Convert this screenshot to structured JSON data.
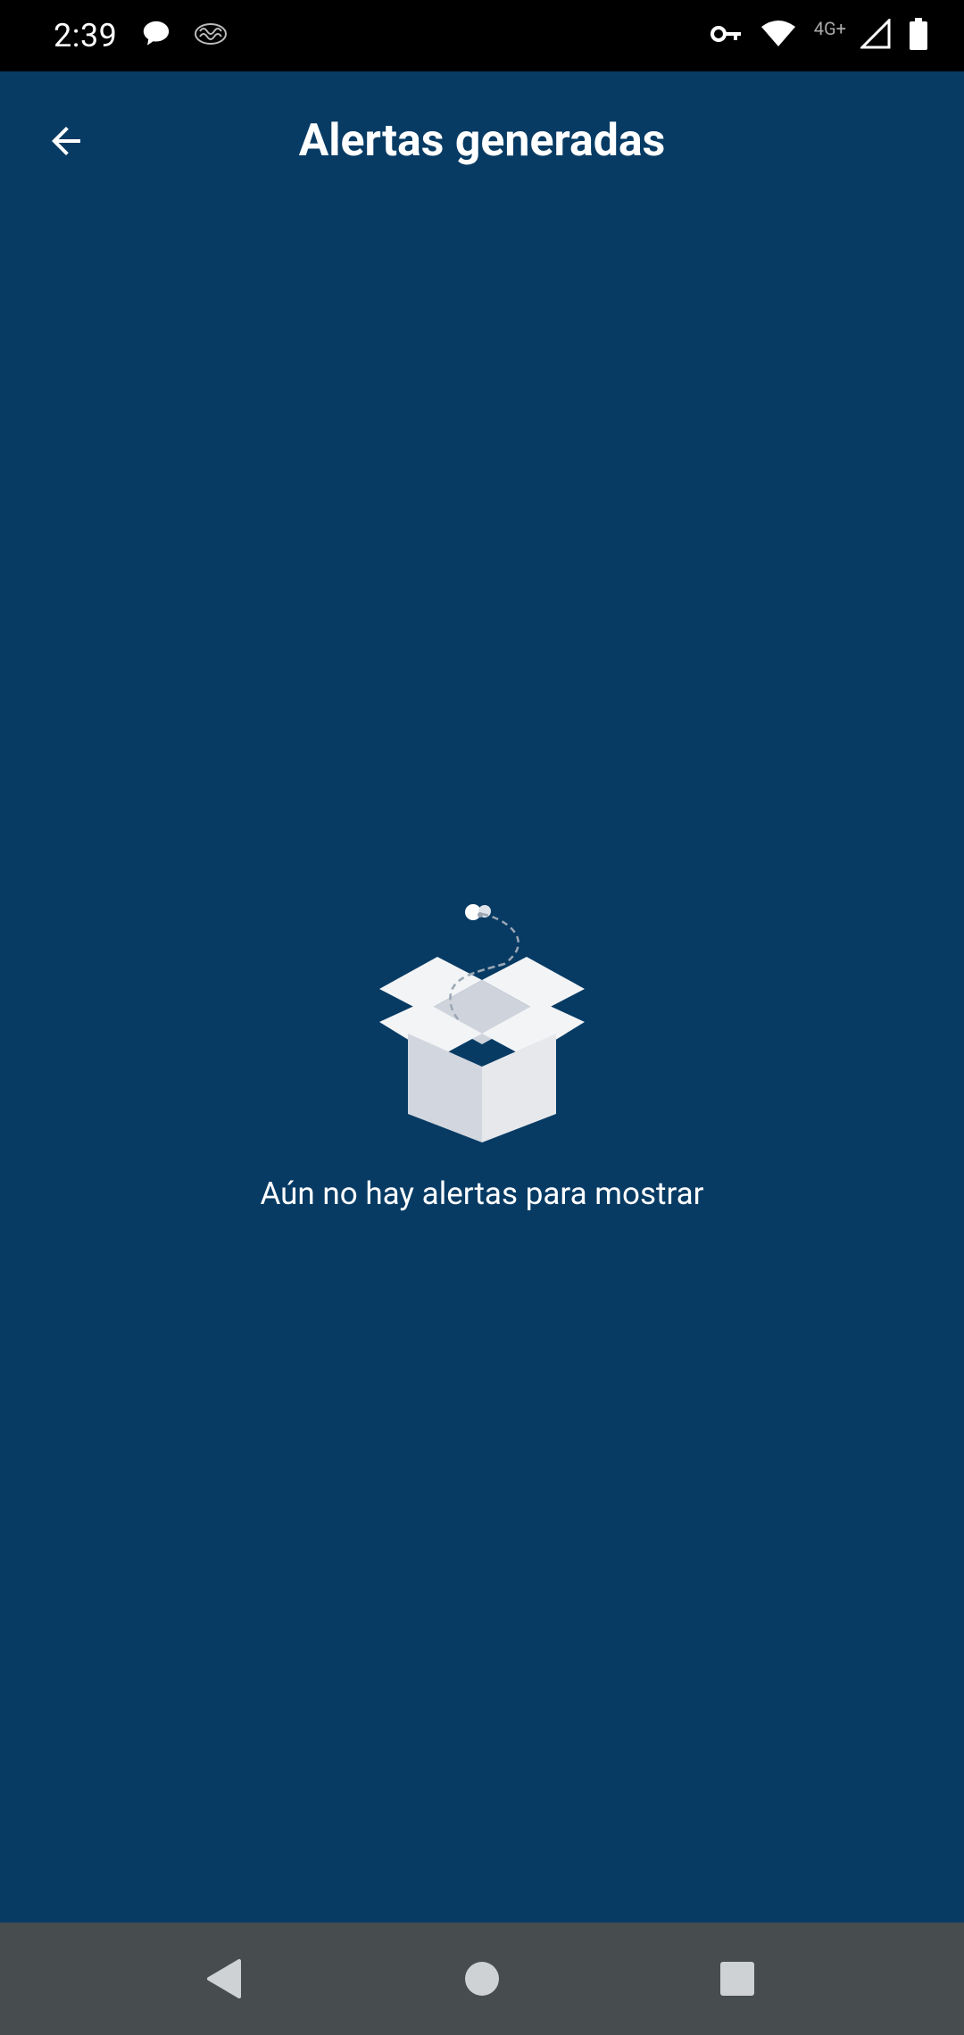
{
  "status_bar": {
    "time": "2:39",
    "left_icons": [
      "chat-bubble-icon",
      "brain-icon"
    ],
    "right_icons": [
      "vpn-key-icon",
      "wifi-icon",
      "cell-signal-icon",
      "battery-icon"
    ],
    "network_label": "4G+"
  },
  "app_bar": {
    "title": "Alertas generadas",
    "back_icon": "arrow-back-icon"
  },
  "empty_state": {
    "illustration": "open-box-icon",
    "message": "Aún no hay alertas para mostrar"
  },
  "nav_bar": {
    "buttons": [
      "back-triangle-icon",
      "home-circle-icon",
      "recents-square-icon"
    ]
  },
  "colors": {
    "background": "#073b64",
    "status_bar": "#000000",
    "nav_bar": "#474c4f",
    "text": "#ffffff"
  }
}
